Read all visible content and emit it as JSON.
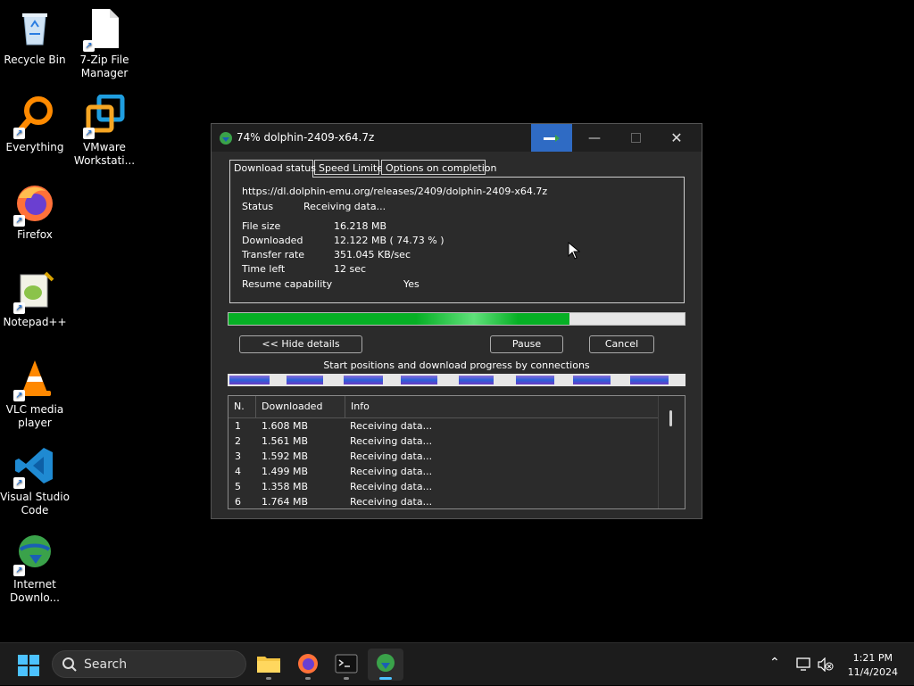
{
  "desktop": {
    "icons": [
      {
        "label": "Recycle Bin"
      },
      {
        "label": "7-Zip File Manager"
      },
      {
        "label": "Everything"
      },
      {
        "label": "VMware Workstati..."
      },
      {
        "label": "Firefox"
      },
      {
        "label": "Notepad++"
      },
      {
        "label": "VLC media player"
      },
      {
        "label": "Visual Studio Code"
      },
      {
        "label": "Internet Downlo..."
      }
    ]
  },
  "window": {
    "title": "74% dolphin-2409-x64.7z",
    "tabs": [
      {
        "label": "Download status",
        "active": true
      },
      {
        "label": "Speed Limiter"
      },
      {
        "label": "Options on completion"
      }
    ],
    "url": "https://dl.dolphin-emu.org/releases/2409/dolphin-2409-x64.7z",
    "status_label": "Status",
    "status_value": "Receiving data...",
    "file_size_label": "File size",
    "file_size_value": "16.218  MB",
    "downloaded_label": "Downloaded",
    "downloaded_value": "12.122  MB  ( 74.73 % )",
    "transfer_rate_label": "Transfer rate",
    "transfer_rate_value": "351.045  KB/sec",
    "time_left_label": "Time left",
    "time_left_value": "12 sec",
    "resume_label": "Resume capability",
    "resume_value": "Yes",
    "progress_fraction": 0.7473,
    "hide_details_label": "<< Hide details",
    "pause_label": "Pause",
    "cancel_label": "Cancel",
    "connections_label": "Start positions and download progress by connections",
    "connections_progress": [
      0.75,
      0.68,
      0.72,
      0.68,
      0.66,
      0.72,
      0.7,
      0.72
    ],
    "table": {
      "columns": [
        "N.",
        "Downloaded",
        "Info"
      ],
      "rows": [
        {
          "n": "1",
          "downloaded": "1.608  MB",
          "info": "Receiving data..."
        },
        {
          "n": "2",
          "downloaded": "1.561  MB",
          "info": "Receiving data..."
        },
        {
          "n": "3",
          "downloaded": "1.592  MB",
          "info": "Receiving data..."
        },
        {
          "n": "4",
          "downloaded": "1.499  MB",
          "info": "Receiving data..."
        },
        {
          "n": "5",
          "downloaded": "1.358  MB",
          "info": "Receiving data..."
        },
        {
          "n": "6",
          "downloaded": "1.764  MB",
          "info": "Receiving data..."
        }
      ]
    }
  },
  "taskbar": {
    "search_label": "Search",
    "time": "1:21 PM",
    "date": "11/4/2024"
  },
  "colors": {
    "progress_green": "#06b025",
    "accent_blue": "#2f6bc4",
    "taskbar_active": "#4cc2ff"
  }
}
